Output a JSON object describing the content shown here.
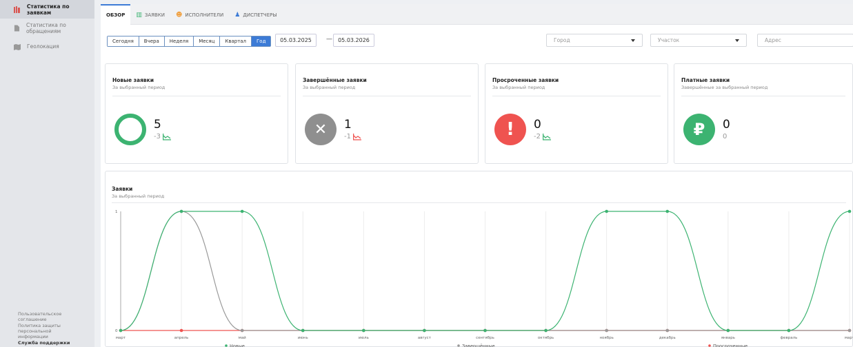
{
  "sidebar": {
    "items": [
      {
        "label": "Статистика по заявкам",
        "icon": "books-icon"
      },
      {
        "label": "Статистика по обращениям",
        "icon": "document-icon"
      },
      {
        "label": "Геолокация",
        "icon": "map-icon"
      }
    ],
    "footer": {
      "agreement": "Пользовательское соглашение",
      "privacy": "Политика защиты персональной информации",
      "support": "Служба поддержки"
    }
  },
  "tabs": [
    {
      "label": "ОБЗОР",
      "icon": ""
    },
    {
      "label": "ЗАЯВКИ",
      "icon": "books-icon"
    },
    {
      "label": "ИСПОЛНИТЕЛИ",
      "icon": "people-icon"
    },
    {
      "label": "ДИСПЕТЧЕРЫ",
      "icon": "person-icon"
    }
  ],
  "periods": [
    "Сегодня",
    "Вчера",
    "Неделя",
    "Месяц",
    "Квартал",
    "Год"
  ],
  "date_from": "05.03.2025",
  "date_sep": "—",
  "date_to": "05.03.2026",
  "filters": {
    "city": "Город",
    "area": "Участок",
    "address": "Адрес"
  },
  "cards": [
    {
      "title": "Новые заявки",
      "subtitle": "За выбранный период",
      "value": "5",
      "delta": "-3",
      "color": "#3cb371",
      "icon": "ring-icon"
    },
    {
      "title": "Завершённые заявки",
      "subtitle": "За выбранный период",
      "value": "1",
      "delta": "-1",
      "color": "#8f8f8f",
      "icon": "close-icon"
    },
    {
      "title": "Просроченные заявки",
      "subtitle": "За выбранный период",
      "value": "0",
      "delta": "-2",
      "color": "#ef5350",
      "icon": "exclamation-icon"
    },
    {
      "title": "Платные заявки",
      "subtitle": "Завершённые за выбранный период",
      "value": "0",
      "delta": "0",
      "color": "#3cb371",
      "icon": "ruble-icon"
    }
  ],
  "chart": {
    "title": "Заявки",
    "subtitle": "За выбранный период"
  },
  "chart_data": {
    "type": "line",
    "x": [
      "март",
      "апрель",
      "май",
      "июнь",
      "июль",
      "август",
      "сентябрь",
      "октябрь",
      "ноябрь",
      "декабрь",
      "январь",
      "февраль",
      "март"
    ],
    "ylim": [
      0,
      1
    ],
    "yticks": [
      "0",
      "1"
    ],
    "series": [
      {
        "name": "Новые",
        "color": "#3cb371",
        "values": [
          0,
          1,
          1,
          0,
          0,
          0,
          0,
          0,
          1,
          1,
          0,
          0,
          1
        ]
      },
      {
        "name": "Завершённые",
        "color": "#999999",
        "values": [
          0,
          1,
          0,
          0,
          0,
          0,
          0,
          0,
          0,
          0,
          0,
          0,
          0
        ]
      },
      {
        "name": "Просроченные",
        "color": "#ef5350",
        "values": [
          0,
          0,
          0,
          0,
          0,
          0,
          0,
          0,
          0,
          0,
          0,
          0,
          0
        ]
      }
    ],
    "legend": "bottom"
  }
}
